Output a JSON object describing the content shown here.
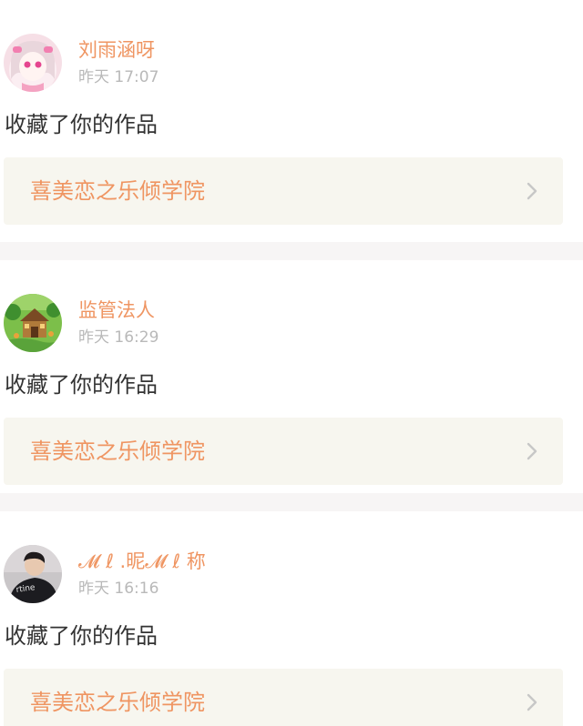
{
  "notifications": [
    {
      "username": "刘雨涵呀",
      "time": "昨天 17:07",
      "action": "收藏了你的作品",
      "work_title": "喜美恋之乐倾学院",
      "avatar": "anime-girl-avatar"
    },
    {
      "username": "监管法人",
      "time": "昨天 16:29",
      "action": "收藏了你的作品",
      "work_title": "喜美恋之乐倾学院",
      "avatar": "game-scene-avatar"
    },
    {
      "username": "𝓜 ℓ .昵𝓜 ℓ 称",
      "time": "昨天 16:16",
      "action": "收藏了你的作品",
      "work_title": "喜美恋之乐倾学院",
      "avatar": "person-photo-avatar"
    }
  ],
  "colors": {
    "accent": "#ef9562",
    "muted": "#b9b9b9",
    "text": "#333333",
    "work_bg": "#f7f6ef",
    "separator": "#f7f5f5"
  },
  "icons": {
    "chevron": "chevron-right-icon"
  }
}
